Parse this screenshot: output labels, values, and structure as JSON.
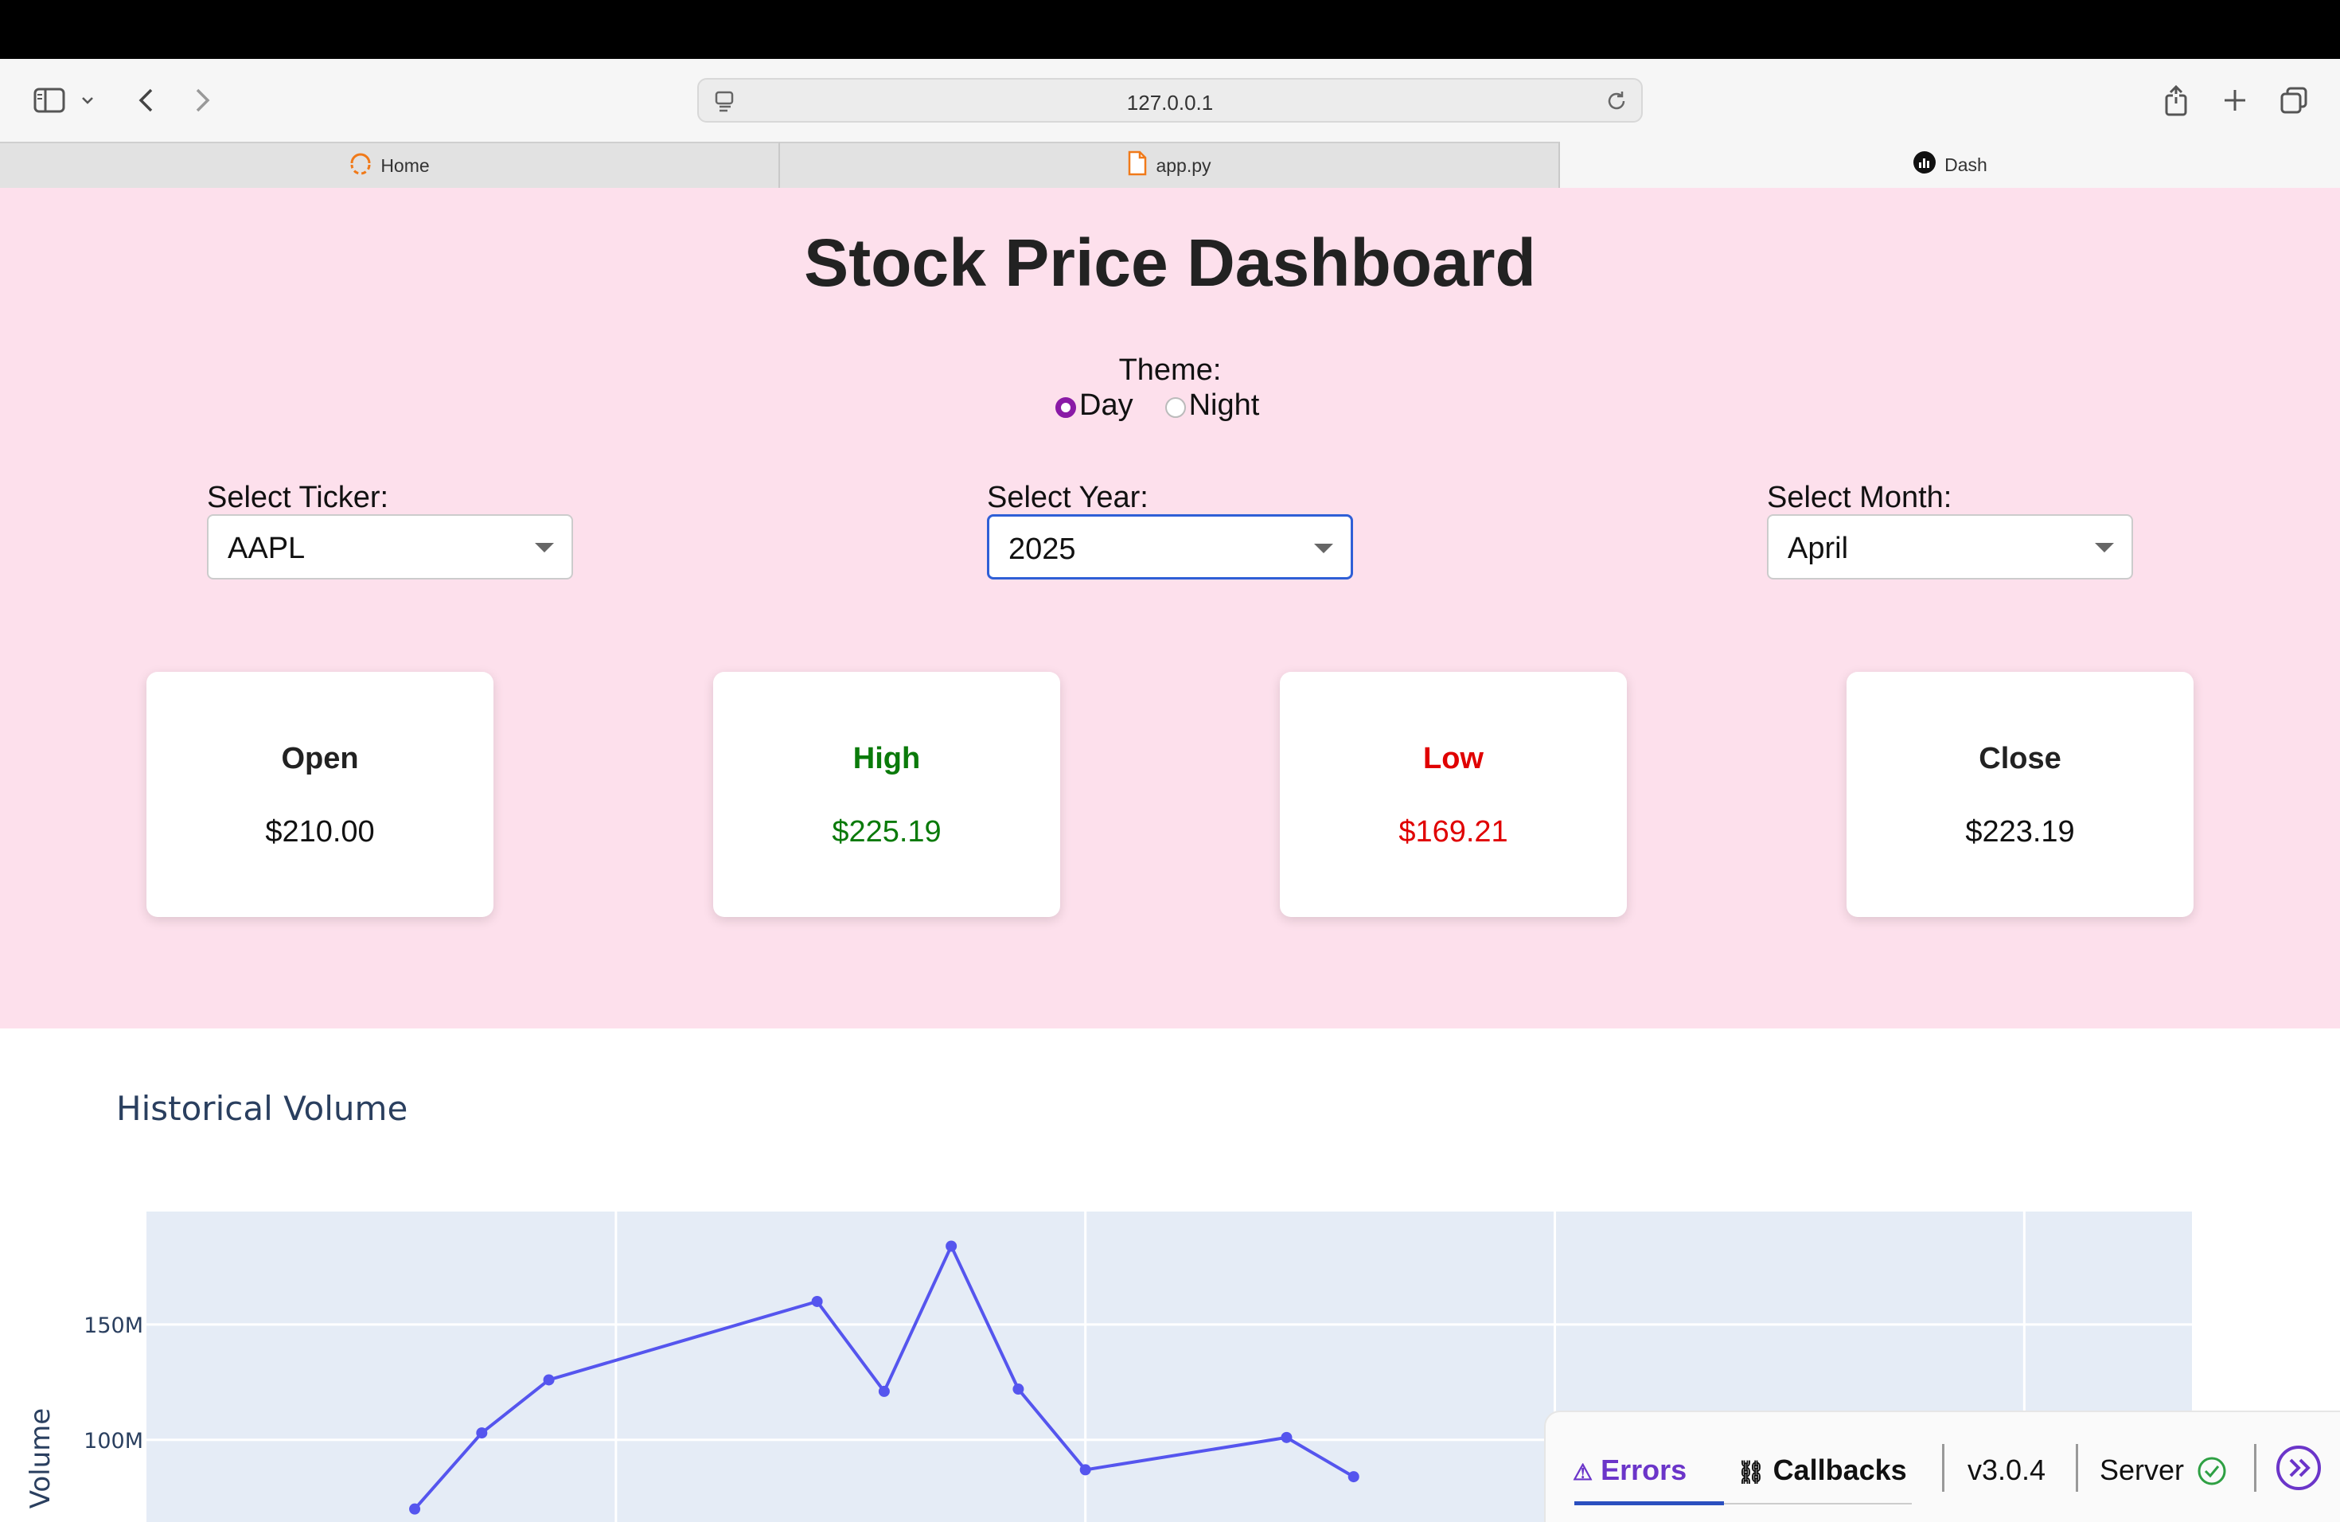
{
  "browser": {
    "url": "127.0.0.1",
    "tabs": [
      {
        "label": "Home",
        "icon": "spinner-icon"
      },
      {
        "label": "app.py",
        "icon": "file-icon"
      },
      {
        "label": "Dash",
        "icon": "dash-logo-icon"
      }
    ]
  },
  "app": {
    "title": "Stock Price Dashboard",
    "theme": {
      "label": "Theme:",
      "options": [
        "Day",
        "Night"
      ],
      "selected": "Day"
    },
    "ticker": {
      "label": "Select Ticker:",
      "value": "AAPL"
    },
    "year": {
      "label": "Select Year:",
      "value": "2025"
    },
    "month": {
      "label": "Select Month:",
      "value": "April"
    },
    "cards": {
      "open": {
        "title": "Open",
        "value": "$210.00"
      },
      "high": {
        "title": "High",
        "value": "$225.19"
      },
      "low": {
        "title": "Low",
        "value": "$169.21"
      },
      "close": {
        "title": "Close",
        "value": "$223.19"
      }
    },
    "colors": {
      "background": "#fde0ec",
      "high": "#0a7a0a",
      "low": "#e00000",
      "line": "#5555ee",
      "radio": "#8a1aa6"
    }
  },
  "chart_data": {
    "type": "line",
    "title": "Historical Volume",
    "ylabel": "Volume",
    "ytick_labels": [
      "100M",
      "150M"
    ],
    "yticks": [
      100000000,
      150000000
    ],
    "ylim": [
      54000000,
      199000000
    ],
    "series": [
      {
        "values": [
          [
            1,
            70000000
          ],
          [
            2,
            103000000
          ],
          [
            3,
            126000000
          ],
          [
            7,
            160000000
          ],
          [
            8,
            121000000
          ],
          [
            9,
            184000000
          ],
          [
            10,
            122000000
          ],
          [
            11,
            87000000
          ],
          [
            14,
            101000000
          ],
          [
            15,
            84000000
          ]
        ]
      }
    ],
    "xlim": [
      -3,
      27.5
    ],
    "grid": true
  },
  "devtools": {
    "errors": "Errors",
    "callbacks": "Callbacks",
    "version": "v3.0.4",
    "server": "Server"
  }
}
